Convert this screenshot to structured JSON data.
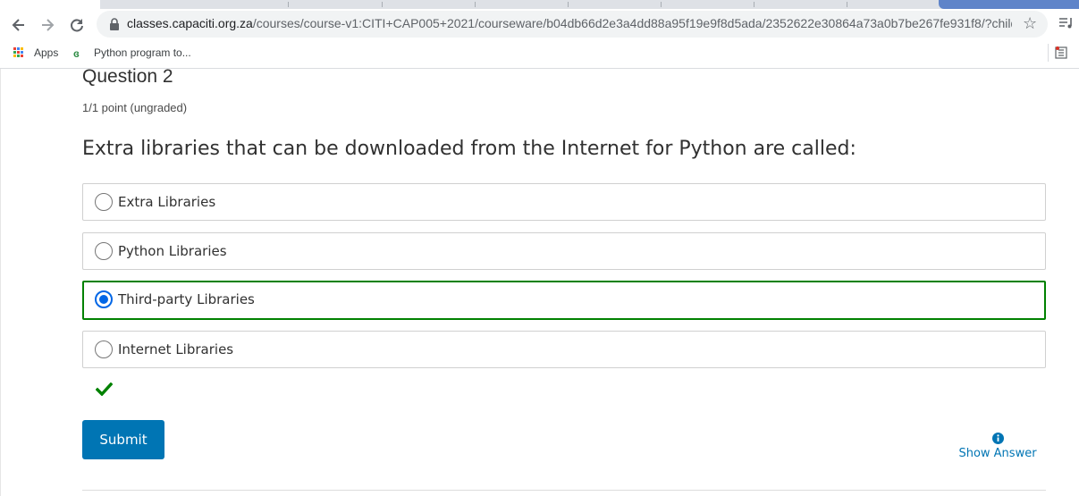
{
  "browser": {
    "url_host": "classes.capaciti.org.za",
    "url_path": "/courses/course-v1:CITI+CAP005+2021/courseware/b04db66d2e3a4dd88a95f19e9f8d5ada/2352622e30864a73a0b7be267fe931f8/?child...",
    "bookmarks": [
      {
        "label": "Apps",
        "icon": "apps-grid-icon"
      },
      {
        "label": "Python program to...",
        "icon": "geeksforgeeks-icon"
      }
    ]
  },
  "question": {
    "title": "Question 2",
    "points": "1/1 point (ungraded)",
    "prompt": "Extra libraries that can be downloaded from the Internet for Python are called:",
    "options": [
      {
        "label": "Extra Libraries",
        "selected": false
      },
      {
        "label": "Python Libraries",
        "selected": false
      },
      {
        "label": "Third-party Libraries",
        "selected": true
      },
      {
        "label": "Internet Libraries",
        "selected": false
      }
    ],
    "result_icon": "checkmark-icon",
    "submit_label": "Submit",
    "show_answer_label": "Show Answer"
  },
  "colors": {
    "primary": "#0075b4",
    "correct": "#008100",
    "radio_selected": "#0066e6"
  }
}
